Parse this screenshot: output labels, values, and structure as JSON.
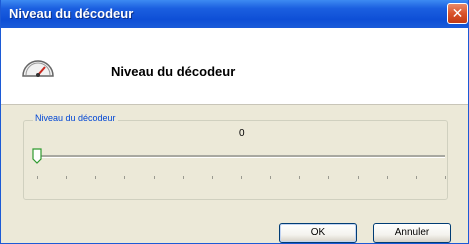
{
  "window": {
    "title": "Niveau du décodeur",
    "close_label": "✕"
  },
  "header": {
    "icon": "gauge-icon",
    "title": "Niveau du décodeur"
  },
  "group": {
    "label": "Niveau du décodeur",
    "value_text": "0"
  },
  "slider": {
    "value": 0,
    "min": 0,
    "max": 14,
    "tick_count": 15
  },
  "buttons": {
    "ok_label": "OK",
    "cancel_label": "Annuler"
  },
  "colors": {
    "titlebar": "#0e4fd6",
    "group_label": "#0046d5",
    "gauge_needle": "#c8281e"
  }
}
